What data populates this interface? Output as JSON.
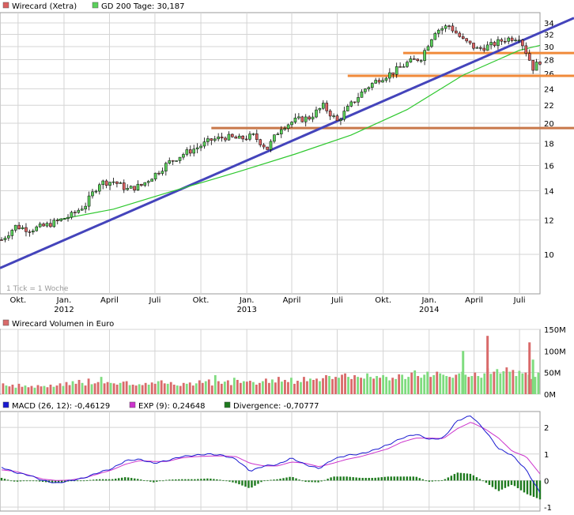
{
  "colors": {
    "up": "#5bd05b",
    "down": "#d96060",
    "gd200": "#2ec82e",
    "trend": "#4444bb",
    "level": "#f08a3a",
    "level_dark": "#c8784a",
    "grid": "#d4d4d4",
    "volume": "#d96a6a",
    "volume_up": "#7fdc7f",
    "macd": "#1a1ad0",
    "exp": "#cc33cc",
    "divergence": "#1e7a1e"
  },
  "price_panel": {
    "legend": [
      {
        "label": "Wirecard (Xetra)",
        "color": "#d96060"
      },
      {
        "label": "GD 200 Tage: 30,187",
        "color": "#5bd05b"
      }
    ],
    "note": "1 Tick = 1 Woche",
    "y_ticks": [
      "34",
      "32",
      "30",
      "28",
      "26",
      "24",
      "22",
      "20",
      "18",
      "16",
      "14",
      "12",
      "10"
    ],
    "x_months": [
      "Okt.",
      "Jan.",
      "April",
      "Juli",
      "Okt.",
      "Jan.",
      "April",
      "Juli",
      "Okt.",
      "Jan.",
      "April",
      "Juli"
    ],
    "x_years": [
      "2012",
      "2013",
      "2014"
    ]
  },
  "volume_panel": {
    "legend": [
      {
        "label": "Wirecard Volumen in Euro",
        "color": "#d96a6a"
      }
    ],
    "y_ticks": [
      "150M",
      "100M",
      "50M",
      "0M"
    ]
  },
  "macd_panel": {
    "legend": [
      {
        "label": "MACD (26, 12): -0,46129",
        "color": "#1a1ad0"
      },
      {
        "label": "EXP (9): 0,24648",
        "color": "#cc33cc"
      },
      {
        "label": "Divergence: -0,70777",
        "color": "#1e7a1e"
      }
    ],
    "y_ticks": [
      "2",
      "1",
      "0",
      "-1"
    ]
  },
  "chart_data": [
    {
      "type": "line",
      "title": "Wirecard (Xetra)",
      "scale": "log",
      "ylim": [
        8.7,
        35.5
      ],
      "x_range": [
        "2011-08-29",
        "2014-08-11"
      ],
      "grid": true,
      "legend_position": "top-left",
      "series": [
        {
          "name": "Wirecard (Xetra)",
          "kind": "candlestick-close",
          "points": [
            [
              "2011-08-29",
              10.8
            ],
            [
              "2011-09-26",
              11.6
            ],
            [
              "2011-10-24",
              11.4
            ],
            [
              "2011-11-21",
              11.6
            ],
            [
              "2011-12-19",
              11.9
            ],
            [
              "2012-01-16",
              12.3
            ],
            [
              "2012-02-13",
              13.0
            ],
            [
              "2012-03-12",
              14.6
            ],
            [
              "2012-04-09",
              14.7
            ],
            [
              "2012-05-07",
              14.1
            ],
            [
              "2012-06-04",
              14.4
            ],
            [
              "2012-07-02",
              15.3
            ],
            [
              "2012-07-30",
              16.3
            ],
            [
              "2012-08-27",
              17.0
            ],
            [
              "2012-09-24",
              17.6
            ],
            [
              "2012-10-22",
              18.3
            ],
            [
              "2012-11-19",
              18.6
            ],
            [
              "2012-12-17",
              18.4
            ],
            [
              "2013-01-14",
              18.7
            ],
            [
              "2013-02-11",
              17.5
            ],
            [
              "2013-03-11",
              19.6
            ],
            [
              "2013-04-08",
              20.3
            ],
            [
              "2013-05-06",
              20.6
            ],
            [
              "2013-06-03",
              21.9
            ],
            [
              "2013-07-01",
              20.2
            ],
            [
              "2013-07-29",
              22.1
            ],
            [
              "2013-08-26",
              24.0
            ],
            [
              "2013-09-23",
              25.3
            ],
            [
              "2013-10-21",
              26.2
            ],
            [
              "2013-11-18",
              27.5
            ],
            [
              "2013-12-16",
              28.3
            ],
            [
              "2014-01-13",
              32.6
            ],
            [
              "2014-02-10",
              33.5
            ],
            [
              "2014-03-10",
              31.0
            ],
            [
              "2014-04-07",
              29.6
            ],
            [
              "2014-05-05",
              30.2
            ],
            [
              "2014-06-02",
              31.2
            ],
            [
              "2014-06-30",
              31.6
            ],
            [
              "2014-07-28",
              26.8
            ],
            [
              "2014-08-11",
              27.8
            ]
          ]
        },
        {
          "name": "GD 200 Tage",
          "points": [
            [
              "2011-12-19",
              12.0
            ],
            [
              "2012-04-09",
              12.7
            ],
            [
              "2012-07-30",
              13.9
            ],
            [
              "2012-12-17",
              15.5
            ],
            [
              "2013-04-08",
              17.0
            ],
            [
              "2013-07-29",
              18.8
            ],
            [
              "2013-11-18",
              21.5
            ],
            [
              "2014-03-10",
              25.8
            ],
            [
              "2014-06-30",
              29.4
            ],
            [
              "2014-08-11",
              30.2
            ]
          ]
        },
        {
          "name": "trend line",
          "points": [
            [
              "2011-08-29",
              9.3
            ],
            [
              "2014-08-11",
              33.2
            ]
          ]
        },
        {
          "name": "level 29",
          "points": [
            [
              "2013-11-10",
              29.0
            ],
            [
              "2014-08-11",
              29.0
            ]
          ]
        },
        {
          "name": "level 25.7",
          "points": [
            [
              "2013-07-22",
              25.7
            ],
            [
              "2014-08-11",
              25.7
            ]
          ]
        },
        {
          "name": "level 19.5",
          "points": [
            [
              "2012-10-22",
              19.5
            ],
            [
              "2014-08-11",
              19.5
            ]
          ]
        }
      ]
    },
    {
      "type": "bar",
      "title": "Wirecard Volumen in Euro",
      "ylim": [
        0,
        150
      ],
      "unit": "M",
      "values": [
        25,
        20,
        18,
        22,
        15,
        24,
        17,
        20,
        16,
        19,
        15,
        21,
        18,
        19,
        16,
        22,
        17,
        20,
        25,
        19,
        28,
        21,
        30,
        24,
        33,
        26,
        20,
        36,
        23,
        25,
        28,
        40,
        25,
        28,
        26,
        25,
        22,
        26,
        29,
        30,
        21,
        22,
        20,
        23,
        21,
        26,
        22,
        27,
        24,
        30,
        32,
        25,
        24,
        28,
        22,
        20,
        19,
        26,
        24,
        27,
        20,
        25,
        32,
        26,
        30,
        34,
        20,
        44,
        30,
        24,
        29,
        32,
        21,
        38,
        33,
        26,
        30,
        29,
        31,
        28,
        22,
        26,
        30,
        36,
        26,
        34,
        27,
        40,
        29,
        33,
        28,
        38,
        24,
        31,
        28,
        40,
        30,
        36,
        33,
        36,
        30,
        37,
        44,
        42,
        35,
        40,
        38,
        45,
        48,
        40,
        35,
        44,
        40,
        38,
        36,
        48,
        40,
        36,
        42,
        38,
        44,
        40,
        32,
        38,
        35,
        46,
        45,
        35,
        40,
        50,
        55,
        42,
        38,
        45,
        52,
        40,
        44,
        52,
        48,
        45,
        42,
        40,
        38,
        45,
        48,
        52,
        45,
        40,
        42,
        50,
        42,
        38,
        48,
        60,
        47,
        52,
        58,
        48,
        53,
        62,
        52,
        56,
        42,
        54,
        48,
        50,
        45,
        35,
        40,
        50
      ],
      "highlights": [
        {
          "x": "2014-03-10",
          "value": 100
        },
        {
          "x": "2014-04-28",
          "value": 135
        },
        {
          "x": "2014-07-21",
          "value": 120
        },
        {
          "x": "2014-07-28",
          "value": 80
        }
      ]
    },
    {
      "type": "line",
      "title": "MACD",
      "ylim": [
        -1,
        2.6
      ],
      "series": [
        {
          "name": "MACD (26, 12)",
          "values": [
            0.5,
            0.3,
            0.2,
            0.0,
            -0.1,
            0.0,
            0.1,
            0.3,
            0.45,
            0.75,
            0.8,
            0.65,
            0.75,
            0.9,
            0.95,
            1.0,
            0.95,
            0.8,
            0.35,
            0.55,
            0.6,
            0.85,
            0.6,
            0.45,
            0.8,
            0.95,
            1.0,
            1.15,
            1.35,
            1.6,
            1.75,
            1.55,
            1.6,
            2.25,
            2.45,
            1.9,
            1.2,
            0.95,
            0.4,
            -0.46
          ]
        },
        {
          "name": "EXP (9)",
          "values": [
            0.4,
            0.35,
            0.2,
            0.05,
            0.0,
            0.02,
            0.1,
            0.25,
            0.4,
            0.62,
            0.75,
            0.72,
            0.72,
            0.85,
            0.9,
            0.92,
            0.93,
            0.9,
            0.65,
            0.55,
            0.55,
            0.7,
            0.65,
            0.52,
            0.65,
            0.8,
            0.9,
            1.05,
            1.2,
            1.45,
            1.6,
            1.6,
            1.58,
            1.95,
            2.2,
            1.95,
            1.6,
            1.1,
            0.9,
            0.25
          ]
        },
        {
          "name": "Divergence",
          "kind": "bar",
          "values": [
            0.1,
            -0.05,
            0.0,
            -0.05,
            -0.1,
            -0.02,
            0.0,
            0.05,
            0.05,
            0.13,
            0.05,
            -0.07,
            0.03,
            0.05,
            0.05,
            0.08,
            0.02,
            -0.1,
            -0.3,
            0.0,
            0.05,
            0.15,
            -0.05,
            -0.07,
            0.15,
            0.15,
            0.1,
            0.1,
            0.15,
            0.15,
            0.15,
            -0.05,
            0.02,
            0.3,
            0.25,
            -0.05,
            -0.4,
            -0.15,
            -0.5,
            -0.71
          ]
        }
      ]
    }
  ]
}
